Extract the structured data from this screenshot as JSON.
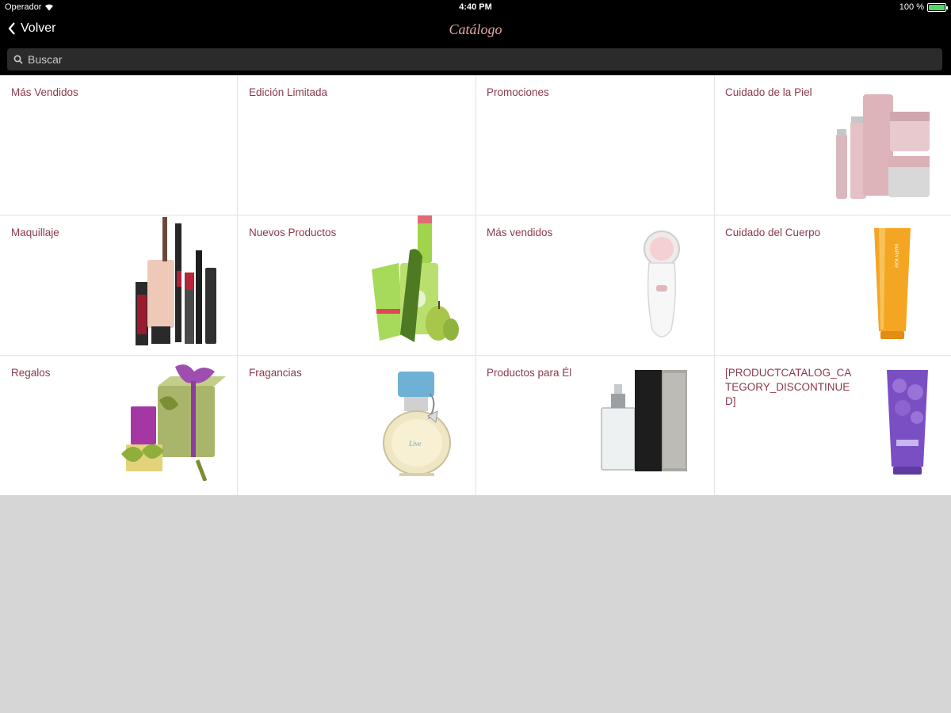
{
  "status_bar": {
    "carrier": "Operador",
    "time": "4:40 PM",
    "battery": "100 %",
    "battery_level": 1.0,
    "icons": [
      "wifi-icon",
      "battery-icon"
    ]
  },
  "nav_bar": {
    "back_label": "Volver",
    "title": "Catálogo",
    "title_color": "#e8a6a6",
    "icons": [
      "chevron-left-icon"
    ]
  },
  "search": {
    "placeholder": "Buscar",
    "icon": "search-icon"
  },
  "colors": {
    "label_color": "#8b3a4c",
    "grid_background": "#ffffff",
    "page_background": "#d6d6d6"
  },
  "categories": [
    {
      "label": "Más Vendidos",
      "image": ""
    },
    {
      "label": "Edición Limitada",
      "image": ""
    },
    {
      "label": "Promociones",
      "image": ""
    },
    {
      "label": "Cuidado de la Piel",
      "image": "skincare-products-image"
    },
    {
      "label": "Maquillaje",
      "image": "makeup-products-image"
    },
    {
      "label": "Nuevos Productos",
      "image": "new-products-image"
    },
    {
      "label": "Más vendidos",
      "image": "cleansing-brush-image"
    },
    {
      "label": "Cuidado del Cuerpo",
      "image": "body-lotion-tube-image"
    },
    {
      "label": "Regalos",
      "image": "gift-boxes-image"
    },
    {
      "label": "Fragancias",
      "image": "perfume-bottle-image"
    },
    {
      "label": "Productos para Él",
      "image": "mens-fragrance-image"
    },
    {
      "label": "[PRODUCTCATALOG_CATEGORY_DISCONTINUED]",
      "image": "purple-tube-image"
    }
  ]
}
